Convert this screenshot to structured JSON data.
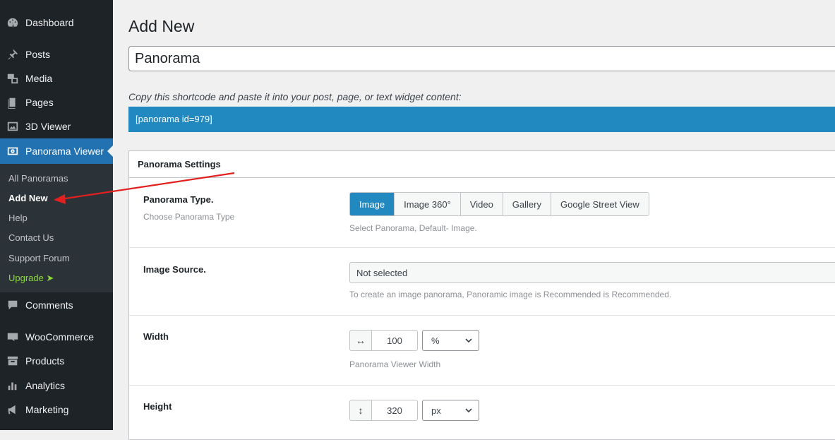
{
  "sidebar": {
    "items": [
      {
        "label": "Dashboard",
        "icon": "dashboard-icon"
      },
      {
        "label": "Posts",
        "icon": "pin-icon"
      },
      {
        "label": "Media",
        "icon": "media-icon"
      },
      {
        "label": "Pages",
        "icon": "pages-icon"
      },
      {
        "label": "3D Viewer",
        "icon": "image-icon"
      },
      {
        "label": "Panorama Viewer",
        "icon": "panorama-icon"
      },
      {
        "label": "Comments",
        "icon": "comment-icon"
      },
      {
        "label": "WooCommerce",
        "icon": "woo-icon"
      },
      {
        "label": "Products",
        "icon": "archive-icon"
      },
      {
        "label": "Analytics",
        "icon": "chart-icon"
      },
      {
        "label": "Marketing",
        "icon": "megaphone-icon"
      }
    ],
    "submenu": [
      {
        "label": "All Panoramas"
      },
      {
        "label": "Add New"
      },
      {
        "label": "Help"
      },
      {
        "label": "Contact Us"
      },
      {
        "label": "Support Forum"
      },
      {
        "label": "Upgrade ➤"
      }
    ]
  },
  "main": {
    "page_title": "Add New",
    "title_value": "Panorama",
    "shortcode_hint": "Copy this shortcode and paste it into your post, page, or text widget content:",
    "shortcode": "[panorama id=979]"
  },
  "settings": {
    "title": "Panorama Settings",
    "panorama_type": {
      "label": "Panorama Type.",
      "sub": "Choose Panorama Type",
      "options": [
        "Image",
        "Image 360°",
        "Video",
        "Gallery",
        "Google Street View"
      ],
      "selected": "Image",
      "desc": "Select Panorama, Default- Image."
    },
    "image_source": {
      "label": "Image Source.",
      "value": "Not selected",
      "desc": "To create an image panorama, Panoramic image is Recommended is Recommended."
    },
    "width": {
      "label": "Width",
      "value": "100",
      "unit": "%",
      "icon": "horizontal-arrows-icon",
      "desc": "Panorama Viewer Width"
    },
    "height": {
      "label": "Height",
      "value": "320",
      "unit": "px",
      "icon": "vertical-arrows-icon"
    }
  },
  "colors": {
    "sidebar_bg": "#1d2327",
    "accent": "#2188c0",
    "active_menu": "#2271b1",
    "upgrade": "#8bd93b",
    "annotation_arrow": "#e32020"
  }
}
